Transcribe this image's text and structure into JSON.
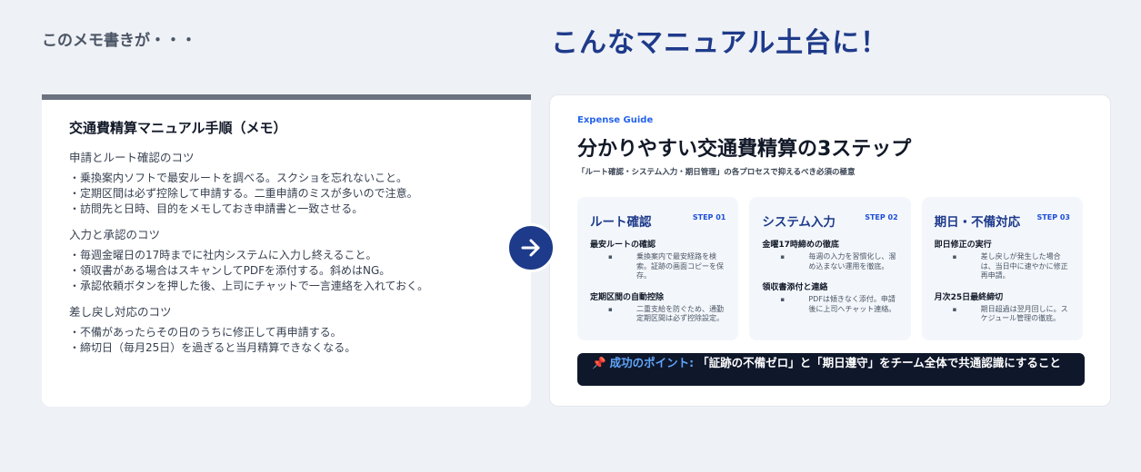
{
  "headings": {
    "left": "このメモ書きが・・・",
    "right": "こんなマニュアル土台に！"
  },
  "memo": {
    "title": "交通費精算マニュアル手順（メモ）",
    "sections": [
      {
        "title": "申請とルート確認のコツ",
        "lines": [
          "・乗換案内ソフトで最安ルートを調べる。スクショを忘れないこと。",
          "・定期区間は必ず控除して申請する。二重申請のミスが多いので注意。",
          "・訪問先と日時、目的をメモしておき申請書と一致させる。"
        ]
      },
      {
        "title": "入力と承認のコツ",
        "lines": [
          "・毎週金曜日の17時までに社内システムに入力し終えること。",
          "・領収書がある場合はスキャンしてPDFを添付する。斜めはNG。",
          "・承認依頼ボタンを押した後、上司にチャットで一言連絡を入れておく。"
        ]
      },
      {
        "title": "差し戻し対応のコツ",
        "lines": [
          "・不備があったらその日のうちに修正して再申請する。",
          "・締切日（毎月25日）を過ぎると当月精算できなくなる。"
        ]
      }
    ]
  },
  "arrow_icon": "arrow-right-icon",
  "guide": {
    "label": "Expense Guide",
    "title": "分かりやすい交通費精算の3ステップ",
    "subtitle": "「ルート確認・システム入力・期日管理」の各プロセスで抑えるべき必須の極意",
    "steps": [
      {
        "title": "ルート確認",
        "step_no": "STEP 01",
        "items": [
          {
            "title": "最安ルートの確認",
            "bullet": "▪",
            "desc": "乗換案内で最安経路を検索。証跡の画面コピーを保存。"
          },
          {
            "title": "定期区間の自動控除",
            "bullet": "▪",
            "desc": "二重支給を防ぐため、通勤定期区間は必ず控除設定。"
          }
        ]
      },
      {
        "title": "システム入力",
        "step_no": "STEP 02",
        "items": [
          {
            "title": "金曜17時締めの徹底",
            "bullet": "▪",
            "desc": "毎週の入力を習慣化し、溜め込まない運用を徹底。"
          },
          {
            "title": "領収書添付と連絡",
            "bullet": "▪",
            "desc": "PDFは傾きなく添付。申請後に上司へチャット連絡。"
          }
        ]
      },
      {
        "title": "期日・不備対応",
        "step_no": "STEP 03",
        "items": [
          {
            "title": "即日修正の実行",
            "bullet": "▪",
            "desc": "差し戻しが発生した場合は、当日中に速やかに修正再申請。"
          },
          {
            "title": "月次25日最終締切",
            "bullet": "▪",
            "desc": "期日超過は翌月回しに。スケジュール管理の徹底。"
          }
        ]
      }
    ],
    "banner": {
      "pin_icon": "pin-icon",
      "pin_glyph": "📌",
      "key": "成功のポイント:",
      "text": "「証跡の不備ゼロ」と「期日遵守」をチーム全体で共通認識にすること"
    }
  },
  "colors": {
    "accent": "#1e3a8a",
    "label_blue": "#2563eb",
    "banner_bg": "#0f172a",
    "memo_top_bar": "#6b7280"
  }
}
